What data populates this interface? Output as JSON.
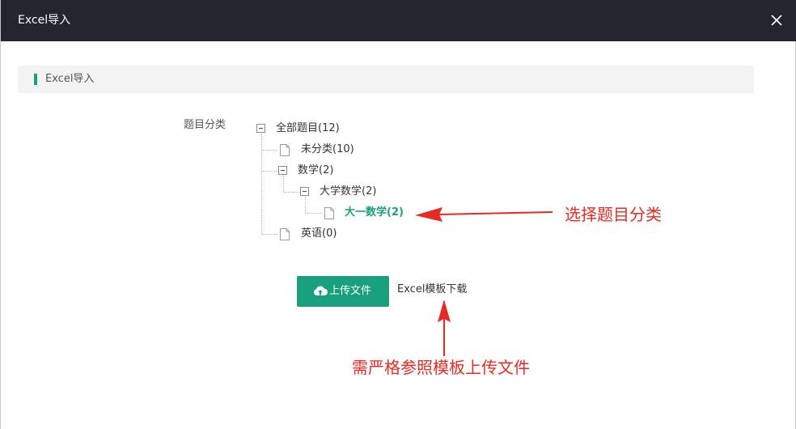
{
  "dialog": {
    "title": "Excel导入",
    "close_icon": "close-icon"
  },
  "section": {
    "heading": "Excel导入",
    "accent_color": "#189f7e"
  },
  "form": {
    "category_label": "题目分类"
  },
  "tree": {
    "root": "全部题目(12)",
    "uncategorized": "未分类(10)",
    "math": "数学(2)",
    "college_math": "大学数学(2)",
    "freshman_math": "大一数学(2)",
    "english": "英语(0)",
    "selected": "大一数学(2)"
  },
  "actions": {
    "upload_label": "上传文件",
    "upload_icon": "cloud-upload-icon",
    "template_link": "Excel模板下载"
  },
  "annotations": {
    "select_category": "选择题目分类",
    "template_note": "需严格参照模板上传文件",
    "color": "#e52b24"
  }
}
